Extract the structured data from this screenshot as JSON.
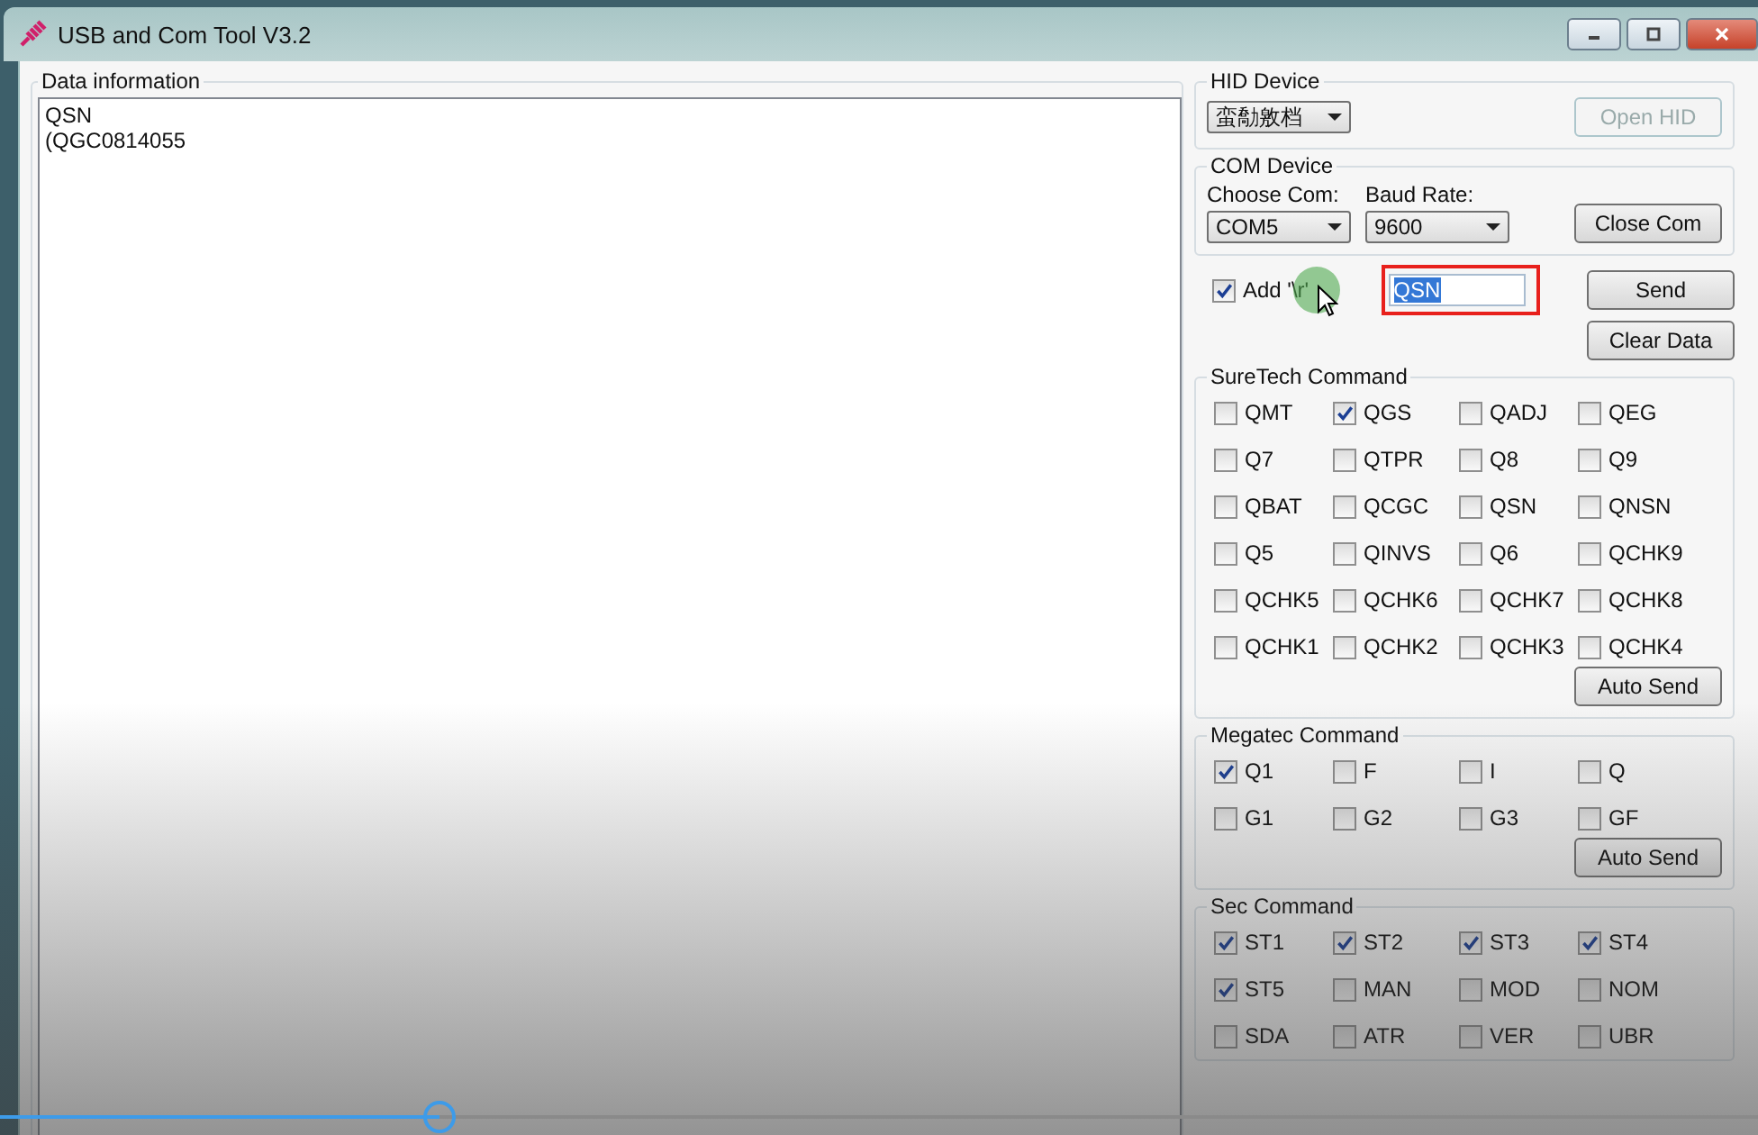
{
  "window": {
    "title": "USB and Com Tool V3.2"
  },
  "data_info": {
    "title": "Data information",
    "lines": [
      "QSN",
      "(QGC0814055"
    ]
  },
  "hid": {
    "title": "HID Device",
    "select": "蛮勪敫档",
    "button": {
      "label": "Open HID",
      "disabled": true
    }
  },
  "com": {
    "title": "COM Device",
    "com_label": "Choose Com:",
    "com_value": "COM5",
    "baud_label": "Baud Rate:",
    "baud_value": "9600",
    "button": "Close Com"
  },
  "add_cr": {
    "label": "Add '\\r'",
    "checked": true
  },
  "command_field": {
    "value": "QSN",
    "selected": true
  },
  "send_button": "Send",
  "clear_button": "Clear Data",
  "groups": [
    {
      "title": "SureTech Command",
      "button": "Auto Send",
      "items": [
        {
          "label": "QMT",
          "checked": false
        },
        {
          "label": "QGS",
          "checked": true
        },
        {
          "label": "QADJ",
          "checked": false
        },
        {
          "label": "QEG",
          "checked": false
        },
        {
          "label": "Q7",
          "checked": false
        },
        {
          "label": "QTPR",
          "checked": false
        },
        {
          "label": "Q8",
          "checked": false
        },
        {
          "label": "Q9",
          "checked": false
        },
        {
          "label": "QBAT",
          "checked": false
        },
        {
          "label": "QCGC",
          "checked": false
        },
        {
          "label": "QSN",
          "checked": false
        },
        {
          "label": "QNSN",
          "checked": false
        },
        {
          "label": "Q5",
          "checked": false
        },
        {
          "label": "QINVS",
          "checked": false
        },
        {
          "label": "Q6",
          "checked": false
        },
        {
          "label": "QCHK9",
          "checked": false
        },
        {
          "label": "QCHK5",
          "checked": false
        },
        {
          "label": "QCHK6",
          "checked": false
        },
        {
          "label": "QCHK7",
          "checked": false
        },
        {
          "label": "QCHK8",
          "checked": false
        },
        {
          "label": "QCHK1",
          "checked": false
        },
        {
          "label": "QCHK2",
          "checked": false
        },
        {
          "label": "QCHK3",
          "checked": false
        },
        {
          "label": "QCHK4",
          "checked": false
        }
      ]
    },
    {
      "title": "Megatec Command",
      "button": "Auto Send",
      "items": [
        {
          "label": "Q1",
          "checked": true
        },
        {
          "label": "F",
          "checked": false
        },
        {
          "label": "I",
          "checked": false
        },
        {
          "label": "Q",
          "checked": false
        },
        {
          "label": "G1",
          "checked": false
        },
        {
          "label": "G2",
          "checked": false
        },
        {
          "label": "G3",
          "checked": false
        },
        {
          "label": "GF",
          "checked": false
        }
      ]
    },
    {
      "title": "Sec Command",
      "items": [
        {
          "label": "ST1",
          "checked": true
        },
        {
          "label": "ST2",
          "checked": true
        },
        {
          "label": "ST3",
          "checked": true
        },
        {
          "label": "ST4",
          "checked": true
        },
        {
          "label": "ST5",
          "checked": true
        },
        {
          "label": "MAN",
          "checked": false
        },
        {
          "label": "MOD",
          "checked": false
        },
        {
          "label": "NOM",
          "checked": false
        },
        {
          "label": "SDA",
          "checked": false
        },
        {
          "label": "ATR",
          "checked": false
        },
        {
          "label": "VER",
          "checked": false
        },
        {
          "label": "UBR",
          "checked": false
        }
      ]
    }
  ],
  "video": {
    "level": 0.25
  }
}
